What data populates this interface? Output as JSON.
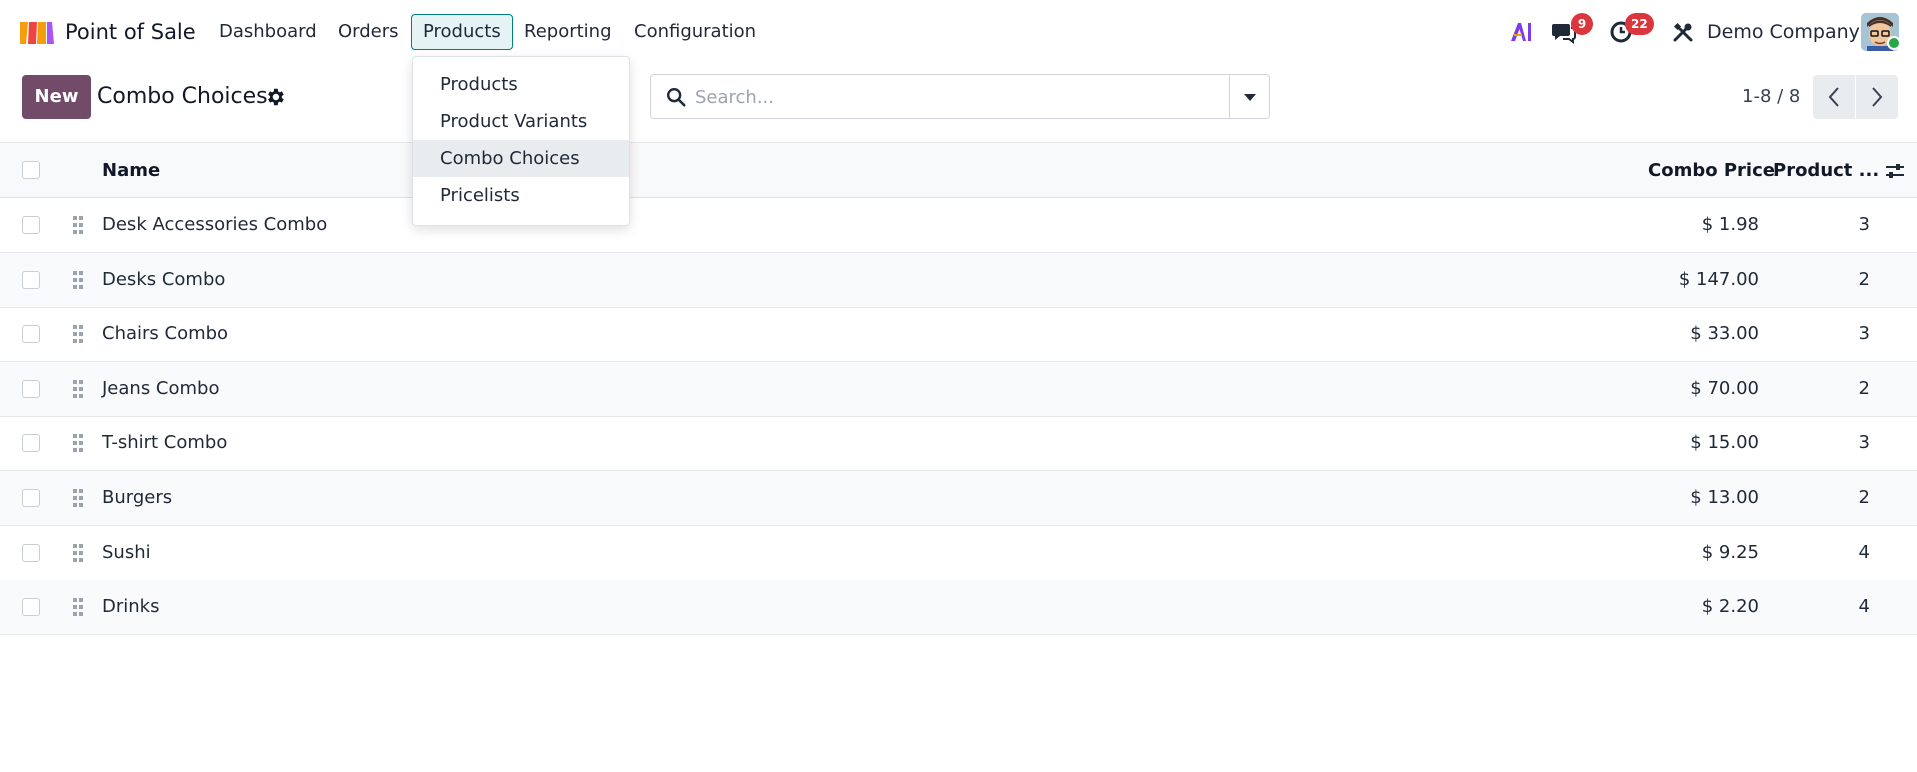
{
  "navbar": {
    "app_name": "Point of Sale",
    "menu": [
      {
        "label": "Dashboard"
      },
      {
        "label": "Orders"
      },
      {
        "label": "Products"
      },
      {
        "label": "Reporting"
      },
      {
        "label": "Configuration"
      }
    ],
    "messages_badge": "9",
    "activities_badge": "22",
    "company": "Demo Company"
  },
  "control_panel": {
    "new_label": "New",
    "title": "Combo Choices",
    "search_placeholder": "Search...",
    "pager": "1-8 / 8"
  },
  "dropdown": {
    "items": [
      {
        "label": "Products"
      },
      {
        "label": "Product Variants"
      },
      {
        "label": "Combo Choices"
      },
      {
        "label": "Pricelists"
      }
    ]
  },
  "table": {
    "columns": {
      "name": "Name",
      "combo_price": "Combo Price",
      "product_count": "Product ..."
    },
    "rows": [
      {
        "name": "Desk Accessories Combo",
        "price": "$ 1.98",
        "count": "3"
      },
      {
        "name": "Desks Combo",
        "price": "$ 147.00",
        "count": "2"
      },
      {
        "name": "Chairs Combo",
        "price": "$ 33.00",
        "count": "3"
      },
      {
        "name": "Jeans Combo",
        "price": "$ 70.00",
        "count": "2"
      },
      {
        "name": "T-shirt Combo",
        "price": "$ 15.00",
        "count": "3"
      },
      {
        "name": "Burgers",
        "price": "$ 13.00",
        "count": "2"
      },
      {
        "name": "Sushi",
        "price": "$ 9.25",
        "count": "4"
      },
      {
        "name": "Drinks",
        "price": "$ 2.20",
        "count": "4"
      }
    ]
  },
  "colors": {
    "brand": "#714b67",
    "active_menu_border": "#017e84",
    "badge": "#d9363e"
  },
  "icons": {
    "logo": "pos-app-logo",
    "ai": "ai-icon",
    "messages": "chat-icon",
    "activities": "clock-icon",
    "debug": "tools-icon",
    "settings": "gear-icon",
    "search": "search-icon",
    "toggle": "caret-down-icon",
    "prev": "chevron-left-icon",
    "next": "chevron-right-icon",
    "drag": "drag-handle-icon",
    "optional_columns": "sliders-icon"
  }
}
